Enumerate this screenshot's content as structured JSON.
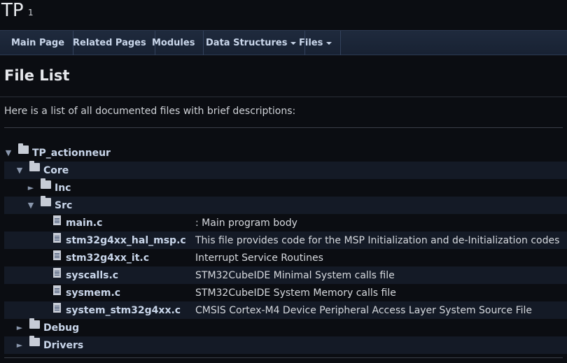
{
  "project": {
    "name": "TP",
    "number": "1"
  },
  "nav": {
    "main_page": "Main Page",
    "related_pages": "Related Pages",
    "modules": "Modules",
    "data_structures": "Data Structures",
    "files": "Files"
  },
  "page": {
    "title": "File List",
    "intro": "Here is a list of all documented files with brief descriptions:"
  },
  "tree": [
    {
      "name": "TP_actionneur",
      "type": "folder",
      "expanded": true,
      "desc": ""
    },
    {
      "name": "Core",
      "type": "folder",
      "expanded": true,
      "desc": ""
    },
    {
      "name": "Inc",
      "type": "folder",
      "expanded": false,
      "desc": ""
    },
    {
      "name": "Src",
      "type": "folder",
      "expanded": true,
      "desc": ""
    },
    {
      "name": "main.c",
      "type": "file",
      "desc": ": Main program body"
    },
    {
      "name": "stm32g4xx_hal_msp.c",
      "type": "file",
      "desc": "This file provides code for the MSP Initialization and de-Initialization codes"
    },
    {
      "name": "stm32g4xx_it.c",
      "type": "file",
      "desc": "Interrupt Service Routines"
    },
    {
      "name": "syscalls.c",
      "type": "file",
      "desc": "STM32CubeIDE Minimal System calls file"
    },
    {
      "name": "sysmem.c",
      "type": "file",
      "desc": "STM32CubeIDE System Memory calls file"
    },
    {
      "name": "system_stm32g4xx.c",
      "type": "file",
      "desc": "CMSIS Cortex-M4 Device Peripheral Access Layer System Source File"
    },
    {
      "name": "Debug",
      "type": "folder",
      "expanded": false,
      "desc": ""
    },
    {
      "name": "Drivers",
      "type": "folder",
      "expanded": false,
      "desc": ""
    }
  ],
  "icons": {
    "expanded": "triangle-down-icon",
    "collapsed": "triangle-right-icon",
    "folder": "folder-icon",
    "file": "file-icon"
  },
  "colors": {
    "background": "#0b0d12",
    "link": "#c9d6ea",
    "navbar": "#1f2a3d"
  }
}
